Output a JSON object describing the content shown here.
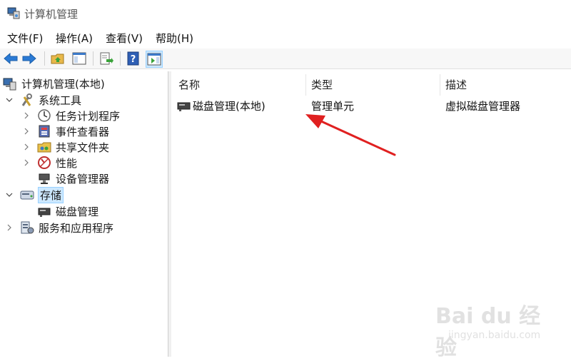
{
  "window": {
    "title": "计算机管理"
  },
  "menu": [
    "文件(F)",
    "操作(A)",
    "查看(V)",
    "帮助(H)"
  ],
  "toolbar": {
    "buttons": [
      "back-icon",
      "forward-icon",
      "up-folder-icon",
      "show-hide-tree-icon",
      "export-list-icon",
      "help-icon",
      "show-hide-action-pane-icon"
    ]
  },
  "tree": {
    "root": "计算机管理(本地)",
    "system_tools": "系统工具",
    "task_scheduler": "任务计划程序",
    "event_viewer": "事件查看器",
    "shared_folders": "共享文件夹",
    "performance": "性能",
    "device_manager": "设备管理器",
    "storage": "存储",
    "disk_management": "磁盘管理",
    "services_apps": "服务和应用程序"
  },
  "list": {
    "columns": [
      "名称",
      "类型",
      "描述"
    ],
    "rows": [
      {
        "name": "磁盘管理(本地)",
        "type": "管理单元",
        "desc": "虚拟磁盘管理器"
      }
    ]
  },
  "watermark": {
    "main": "Bai du 经验",
    "sub": "jingyan.baidu.com"
  },
  "colors": {
    "selection": "#cce8ff",
    "arrow": "#e02020",
    "accent": "#2a7ad5"
  }
}
